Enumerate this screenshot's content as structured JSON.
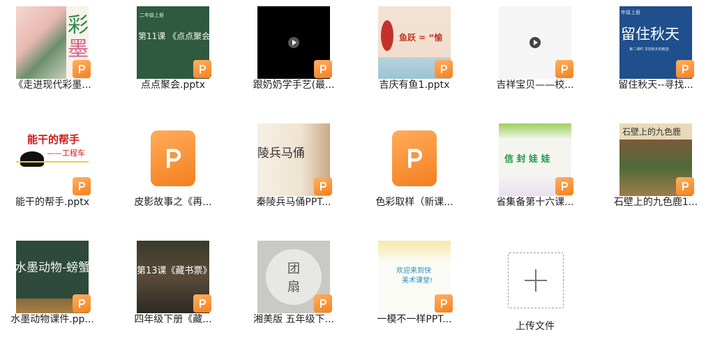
{
  "files": [
    {
      "name": "《走进现代彩墨...",
      "thumb_text": [
        "彩",
        "墨"
      ]
    },
    {
      "name": "点点聚会.pptx",
      "thumb_text": [
        "二年级上册",
        "第11课 《点点聚会"
      ]
    },
    {
      "name": "跟奶奶学手艺(最...",
      "thumb_text": []
    },
    {
      "name": "吉庆有鱼1.pptx",
      "thumb_text": [
        "鱼跃 = “愉"
      ]
    },
    {
      "name": "吉祥宝贝——校...",
      "thumb_text": []
    },
    {
      "name": "留住秋天--寻找...",
      "thumb_text": [
        "年级上册",
        "留住秋天",
        "第二课时 寻找秋天的痕迹"
      ]
    },
    {
      "name": "能干的帮手.pptx",
      "thumb_text": [
        "能干的帮手",
        "——工程车"
      ]
    },
    {
      "name": "皮影故事之《再...",
      "thumb_text": []
    },
    {
      "name": "秦陵兵马俑PPT...",
      "thumb_text": [
        "陵兵马俑"
      ]
    },
    {
      "name": "色彩取样（新课...",
      "thumb_text": []
    },
    {
      "name": "省集备第十六课...",
      "thumb_text": [
        "信 封 娃 娃"
      ]
    },
    {
      "name": "石壁上的九色鹿1...",
      "thumb_text": [
        "石壁上的九色鹿"
      ]
    },
    {
      "name": "水墨动物课件.pp...",
      "thumb_text": [
        "水墨动物-螃蟹"
      ]
    },
    {
      "name": "四年级下册《藏...",
      "thumb_text": [
        "第13课《藏书票》"
      ]
    },
    {
      "name": "湘美版 五年级下...",
      "thumb_text": [
        "团",
        "扇"
      ]
    },
    {
      "name": "一模不一样PPT...",
      "thumb_text": [
        "欢迎来到快",
        "美术课堂!"
      ]
    }
  ],
  "upload": {
    "label": "上传文件"
  },
  "colors": {
    "badge": "#f5801f",
    "upload_border": "#9aa0a6"
  }
}
